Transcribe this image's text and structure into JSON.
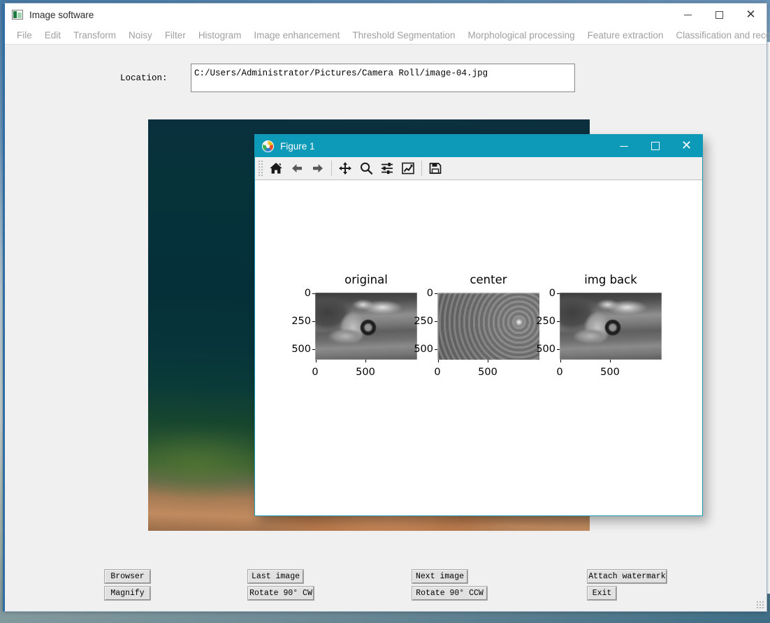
{
  "app": {
    "title": "Image software",
    "icon": "app-image-icon",
    "window_controls": {
      "minimize": "–",
      "maximize": "□",
      "close": "✕"
    }
  },
  "menubar": {
    "items": [
      {
        "label": "File"
      },
      {
        "label": "Edit"
      },
      {
        "label": "Transform"
      },
      {
        "label": "Noisy"
      },
      {
        "label": "Filter"
      },
      {
        "label": "Histogram"
      },
      {
        "label": "Image enhancement"
      },
      {
        "label": "Threshold Segmentation"
      },
      {
        "label": "Morphological processing"
      },
      {
        "label": "Feature extraction"
      },
      {
        "label": "Classification and recognition"
      }
    ]
  },
  "location": {
    "label": "Location:",
    "value": "C:/Users/Administrator/Pictures/Camera Roll/image-04.jpg",
    "placeholder": ""
  },
  "preview": {
    "name": "image-preview",
    "description": "blurred dark teal night scene with hand at bottom"
  },
  "figure": {
    "title": "Figure 1",
    "icon": "matplotlib-icon",
    "window_controls": {
      "minimize": "–",
      "maximize": "□",
      "close": "✕"
    },
    "toolbar": [
      {
        "name": "home-icon",
        "tooltip": "Home"
      },
      {
        "name": "back-arrow-icon",
        "tooltip": "Back"
      },
      {
        "name": "forward-arrow-icon",
        "tooltip": "Forward"
      },
      {
        "name": "pan-move-icon",
        "tooltip": "Pan"
      },
      {
        "name": "zoom-magnifier-icon",
        "tooltip": "Zoom"
      },
      {
        "name": "configure-subplots-icon",
        "tooltip": "Configure subplots"
      },
      {
        "name": "edit-axis-icon",
        "tooltip": "Edit axis, curve and image parameters"
      },
      {
        "name": "save-floppy-icon",
        "tooltip": "Save the figure"
      }
    ]
  },
  "chart_data": {
    "type": "heatmap",
    "title": "",
    "layout": "1 row x 3 columns of images",
    "panels": [
      {
        "title": "original",
        "kind": "grayscale image",
        "xlabel": "",
        "ylabel": "",
        "xticks": [
          0,
          500
        ],
        "yticks": [
          0,
          250,
          500
        ],
        "xlim": [
          0,
          800
        ],
        "ylim": [
          600,
          0
        ],
        "grid": false,
        "description": "grayscale photo: hand holding a camera lens in front of a landscape"
      },
      {
        "title": "center",
        "kind": "fft magnitude spectrum (centered)",
        "xlabel": "",
        "ylabel": "",
        "xticks": [
          0,
          500
        ],
        "yticks": [
          0,
          250,
          500
        ],
        "xlim": [
          0,
          800
        ],
        "ylim": [
          600,
          0
        ],
        "grid": false,
        "description": "centered log magnitude spectrum with bright cross and concentric rings"
      },
      {
        "title": "img back",
        "kind": "grayscale image",
        "xlabel": "",
        "ylabel": "",
        "xticks": [
          0,
          500
        ],
        "yticks": [
          0,
          250,
          500
        ],
        "xlim": [
          0,
          800
        ],
        "ylim": [
          600,
          0
        ],
        "grid": false,
        "description": "inverse FFT reconstruction of the original image"
      }
    ],
    "legend": null,
    "legend_position": "none"
  },
  "buttons": [
    {
      "label": "Browser",
      "name": "browser-button"
    },
    {
      "label": "Magnify",
      "name": "magnify-button"
    },
    {
      "label": "Last image",
      "name": "last-image-button"
    },
    {
      "label": "Rotate 90° CW",
      "name": "rotate-cw-button"
    },
    {
      "label": "Next image",
      "name": "next-image-button"
    },
    {
      "label": "Rotate 90°  CCW",
      "name": "rotate-ccw-button"
    },
    {
      "label": "Attach watermark",
      "name": "attach-watermark-button"
    },
    {
      "label": "Exit",
      "name": "exit-button"
    }
  ],
  "colors": {
    "figure_titlebar": "#0d9ab8",
    "window_bg": "#f0f0f0",
    "menu_text": "#a0a0a0",
    "button_face": "#e1e1e1"
  }
}
